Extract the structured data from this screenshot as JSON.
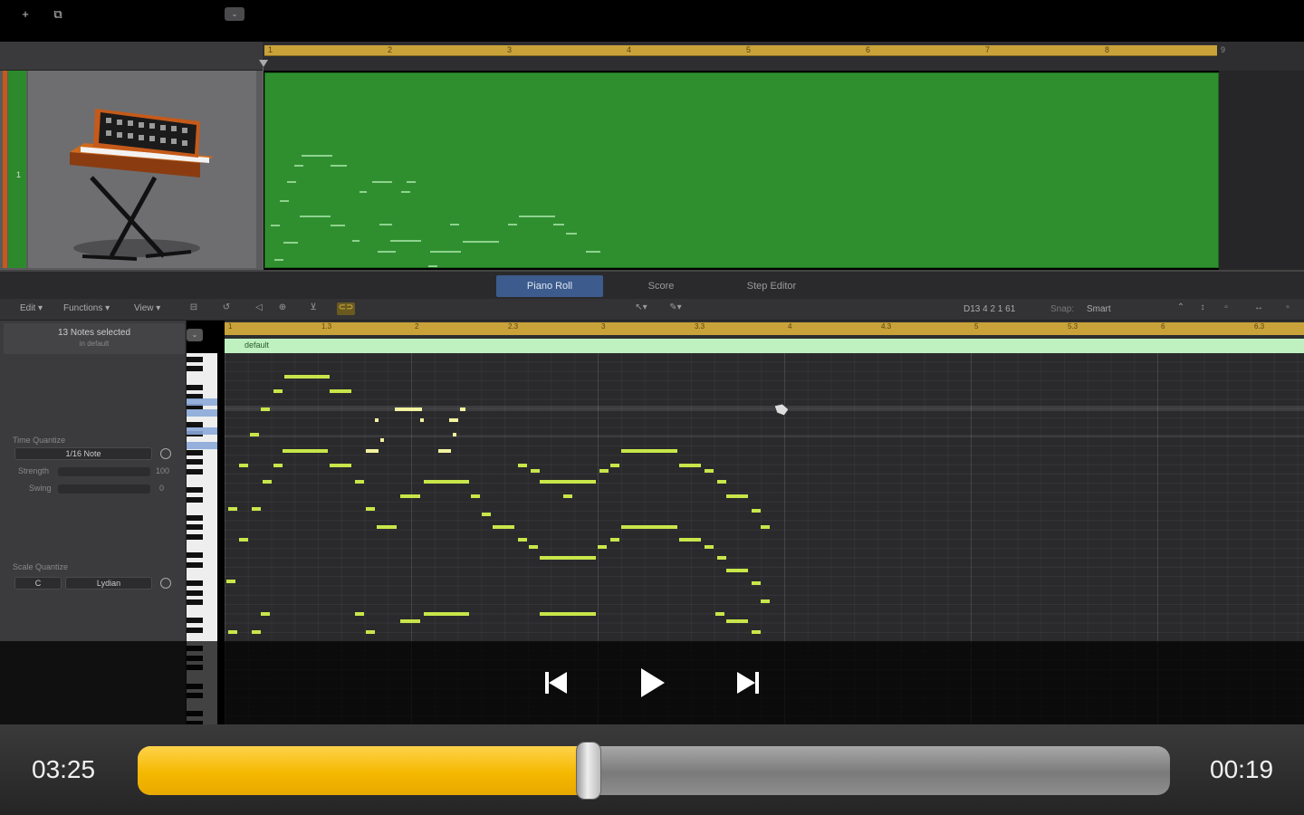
{
  "tracks": {
    "header_buttons": [
      "+",
      "⧉",
      "⌄"
    ],
    "ruler_numbers": [
      "1",
      "2",
      "3",
      "4",
      "5",
      "6",
      "7",
      "8",
      "9"
    ],
    "track_number": "1",
    "instrument_icon": "modular-synth-keyboard-icon",
    "region_color": "#2f8f2f"
  },
  "editor_tabs": [
    {
      "label": "Piano Roll",
      "active": true
    },
    {
      "label": "Score",
      "active": false
    },
    {
      "label": "Step Editor",
      "active": false
    }
  ],
  "toolbar": {
    "edit": "Edit",
    "functions": "Functions",
    "view": "View",
    "position": "D13   4 2 1 61",
    "snap_label": "Snap:",
    "snap_value": "Smart"
  },
  "inspector": {
    "title": "13 Notes selected",
    "subtitle": "in default",
    "time_quantize_label": "Time Quantize",
    "time_quantize_value": "1/16 Note",
    "strength_label": "Strength",
    "strength_value": "100",
    "swing_label": "Swing",
    "swing_value": "0",
    "scale_quantize_label": "Scale Quantize",
    "scale_root": "C",
    "scale_mode": "Lydian"
  },
  "piano_roll": {
    "ruler_ticks": [
      "1",
      "1.3",
      "2",
      "2.3",
      "3",
      "3.3",
      "4",
      "4.3",
      "5",
      "5.3",
      "6",
      "6.3"
    ],
    "region_name": "default",
    "note_color": "#c8e64a"
  },
  "player": {
    "elapsed": "03:25",
    "remaining": "00:19",
    "progress_percent": 43.7,
    "accent": "#f5b800"
  }
}
